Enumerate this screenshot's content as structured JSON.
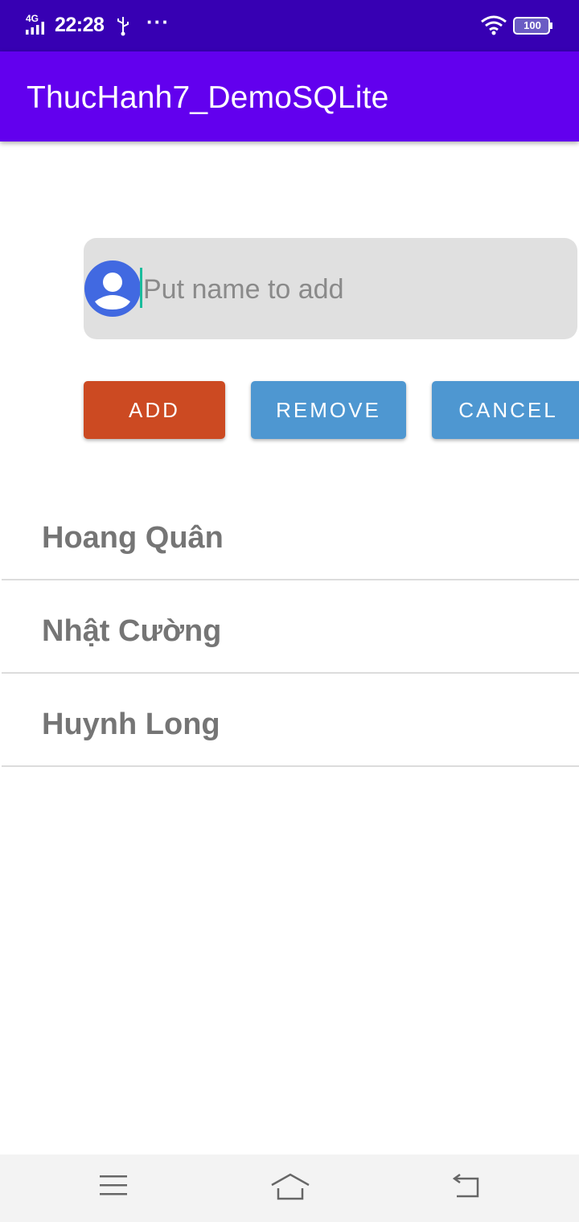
{
  "status_bar": {
    "network": "4G",
    "time": "22:28",
    "more": "···",
    "battery": "100"
  },
  "app_bar": {
    "title": "ThucHanh7_DemoSQLite"
  },
  "input": {
    "value": "",
    "placeholder": "Put name to add"
  },
  "buttons": {
    "add": "ADD",
    "remove": "REMOVE",
    "cancel": "CANCEL"
  },
  "names": [
    "Hoang Quân",
    "Nhật Cường",
    "Huynh Long"
  ],
  "colors": {
    "status_bar": "#3700b3",
    "app_bar": "#6200ee",
    "add_button": "#cc4a22",
    "secondary_button": "#4e97d1",
    "avatar": "#4169e1"
  },
  "icons": {
    "avatar": "account-circle-icon",
    "nav": [
      "menu-icon",
      "home-icon",
      "back-icon"
    ]
  }
}
